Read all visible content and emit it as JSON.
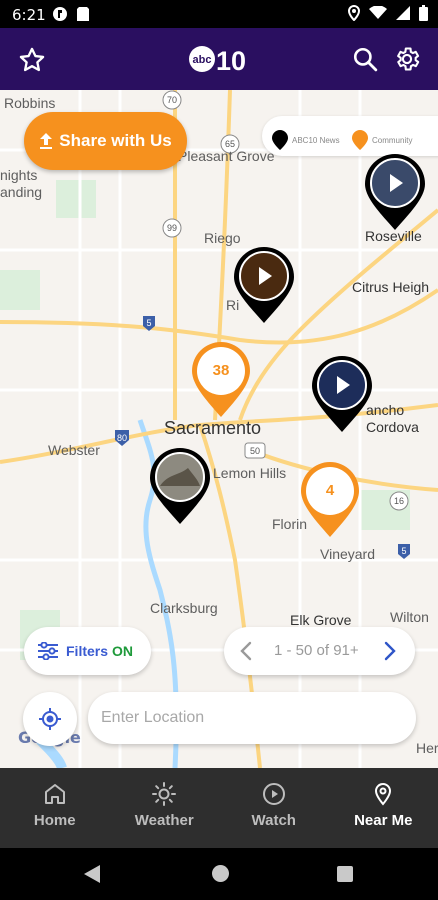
{
  "status_bar": {
    "time": "6:21"
  },
  "app_bar": {
    "logo_text": "abc10"
  },
  "map": {
    "places": [
      {
        "id": "robbins",
        "label": "Robbins"
      },
      {
        "id": "pleasant-grove",
        "label": "Pleasant Grove"
      },
      {
        "id": "knights-landing",
        "label": "nights\nanding"
      },
      {
        "id": "riego",
        "label": "Riego"
      },
      {
        "id": "roseville",
        "label": "Roseville"
      },
      {
        "id": "citrus-heights",
        "label": "Citrus Heigh"
      },
      {
        "id": "rio-linda",
        "label": "Ri"
      },
      {
        "id": "sacramento",
        "label": "Sacramento"
      },
      {
        "id": "webster",
        "label": "Webster"
      },
      {
        "id": "rancho-cordova",
        "label": "ancho\nCordova"
      },
      {
        "id": "lemon-hills",
        "label": "Lemon Hills"
      },
      {
        "id": "florin",
        "label": "Florin"
      },
      {
        "id": "vineyard",
        "label": "Vineyard"
      },
      {
        "id": "clarksburg",
        "label": "Clarksburg"
      },
      {
        "id": "elk-grove",
        "label": "Elk Grove"
      },
      {
        "id": "wilton",
        "label": "Wilton"
      },
      {
        "id": "here",
        "label": "Here"
      }
    ],
    "highway_shields": [
      "70",
      "65",
      "99",
      "5",
      "80",
      "50",
      "16",
      "5"
    ],
    "google_attribution": "Google"
  },
  "share_button": {
    "label": "Share with Us"
  },
  "legend": {
    "abc10": {
      "label": "ABC10 News",
      "color": "#000000"
    },
    "community": {
      "label": "Community",
      "color": "#f6911e"
    }
  },
  "clusters": [
    {
      "id": "cluster-38",
      "count": "38"
    },
    {
      "id": "cluster-4",
      "count": "4"
    }
  ],
  "filters": {
    "label": "Filters",
    "state": "ON"
  },
  "pager": {
    "range": "1 - 50 of 91+"
  },
  "location_input": {
    "placeholder": "Enter Location",
    "value": ""
  },
  "bottom_nav": [
    {
      "label": "Home",
      "icon": "home-icon",
      "active": false
    },
    {
      "label": "Weather",
      "icon": "sun-icon",
      "active": false
    },
    {
      "label": "Watch",
      "icon": "play-circle-icon",
      "active": false
    },
    {
      "label": "Near Me",
      "icon": "location-pin-icon",
      "active": true
    }
  ],
  "colors": {
    "brand_purple": "#2a0f60",
    "accent_orange": "#f6911e",
    "filter_on_green": "#1e9a3a",
    "filter_blue": "#3a5bd1",
    "nav_bg": "#2e2e2e"
  }
}
